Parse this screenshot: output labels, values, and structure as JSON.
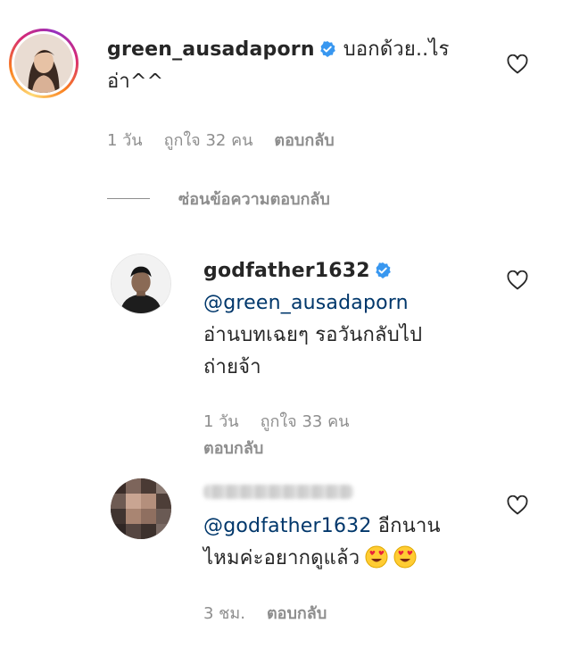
{
  "comments": [
    {
      "username": "green_ausadaporn",
      "verified": true,
      "text_line1": "บอกด้วย..ไร",
      "text_line2": "อ่า^^",
      "time": "1 วัน",
      "likes": "ถูกใจ 32 คน",
      "reply": "ตอบกลับ"
    }
  ],
  "thread": {
    "hide_replies": "ซ่อนข้อความตอบกลับ"
  },
  "replies": [
    {
      "username": "godfather1632",
      "verified": true,
      "mention": "@green_ausadaporn",
      "text_line1": "อ่านบทเฉยๆ รอวันกลับไป",
      "text_line2": "ถ่ายจ้า",
      "time": "1 วัน",
      "likes": "ถูกใจ 33 คน",
      "reply": "ตอบกลับ"
    },
    {
      "username_blurred": true,
      "mention": "@godfather1632",
      "text_line1": "อีกนาน",
      "text_line2": "ไหมค่ะอยากดูแล้ว",
      "emojis": [
        "heart-eyes-icon",
        "heart-eyes-icon"
      ],
      "time": "3 ชม.",
      "reply": "ตอบกลับ"
    }
  ],
  "colors": {
    "username": "#262626",
    "mention": "#00376b",
    "meta": "#8e8e8e",
    "verified": "#3897f0"
  }
}
